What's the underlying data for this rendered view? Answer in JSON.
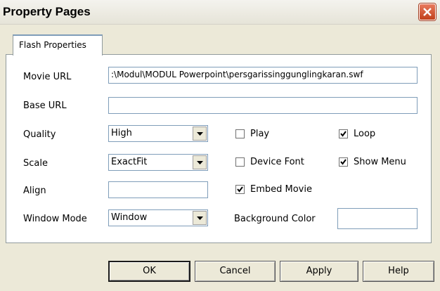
{
  "window": {
    "title": "Property Pages"
  },
  "tabs": [
    {
      "label": "Flash Properties"
    }
  ],
  "fields": {
    "movie_url": {
      "label": "Movie URL",
      "value": ":\\Modul\\MODUL Powerpoint\\persgarissinggunglingkaran.swf"
    },
    "base_url": {
      "label": "Base URL",
      "value": ""
    },
    "quality": {
      "label": "Quality",
      "value": "High"
    },
    "scale": {
      "label": "Scale",
      "value": "ExactFit"
    },
    "align": {
      "label": "Align",
      "value": ""
    },
    "window_mode": {
      "label": "Window Mode",
      "value": "Window"
    },
    "background_color": {
      "label": "Background Color",
      "value": ""
    }
  },
  "checkboxes": {
    "play": {
      "label": "Play",
      "checked": false
    },
    "loop": {
      "label": "Loop",
      "checked": true
    },
    "device_font": {
      "label": "Device Font",
      "checked": false
    },
    "show_menu": {
      "label": "Show Menu",
      "checked": true
    },
    "embed_movie": {
      "label": "Embed Movie",
      "checked": true
    }
  },
  "buttons": {
    "ok": "OK",
    "cancel": "Cancel",
    "apply": "Apply",
    "help": "Help"
  },
  "colors": {
    "panel": "#ffffff",
    "dialog": "#ece9d8",
    "close": "#d2502d",
    "field_border": "#7f9db9"
  }
}
